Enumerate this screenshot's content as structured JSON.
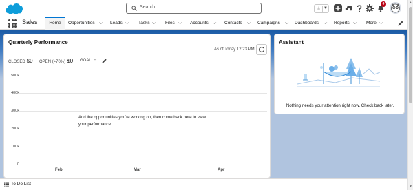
{
  "header": {
    "logo": "salesforce-cloud-logo",
    "search_placeholder": "Search...",
    "icons": [
      "favorites-star-icon",
      "add-icon",
      "trailhead-icon",
      "help-icon",
      "setup-gear-icon",
      "notifications-bell-icon",
      "avatar"
    ],
    "notification_count": "4",
    "brand_color": "#0176d3"
  },
  "nav": {
    "app_name": "Sales",
    "tabs": [
      {
        "label": "Home",
        "active": true
      },
      {
        "label": "Opportunities"
      },
      {
        "label": "Leads"
      },
      {
        "label": "Tasks"
      },
      {
        "label": "Files"
      },
      {
        "label": "Accounts"
      },
      {
        "label": "Contacts"
      },
      {
        "label": "Campaigns"
      },
      {
        "label": "Dashboards"
      },
      {
        "label": "Reports"
      },
      {
        "label": "More"
      }
    ]
  },
  "performance": {
    "title": "Quarterly Performance",
    "as_of": "As of Today 12:23 PM",
    "closed_label": "CLOSED",
    "closed_value": "$0",
    "open_label": "OPEN (>70%)",
    "open_value": "$0",
    "goal_label": "GOAL",
    "goal_value": "--",
    "empty_message": "Add the opportunities you're working on, then come back here to view your performance.",
    "y_ticks": [
      "500k",
      "400k",
      "300k",
      "200k",
      "100k",
      "0"
    ],
    "x_ticks": [
      "Feb",
      "Mar",
      "Apr"
    ]
  },
  "assistant": {
    "title": "Assistant",
    "message": "Nothing needs your attention right now. Check back later."
  },
  "footer": {
    "utility_label": "To Do List"
  }
}
